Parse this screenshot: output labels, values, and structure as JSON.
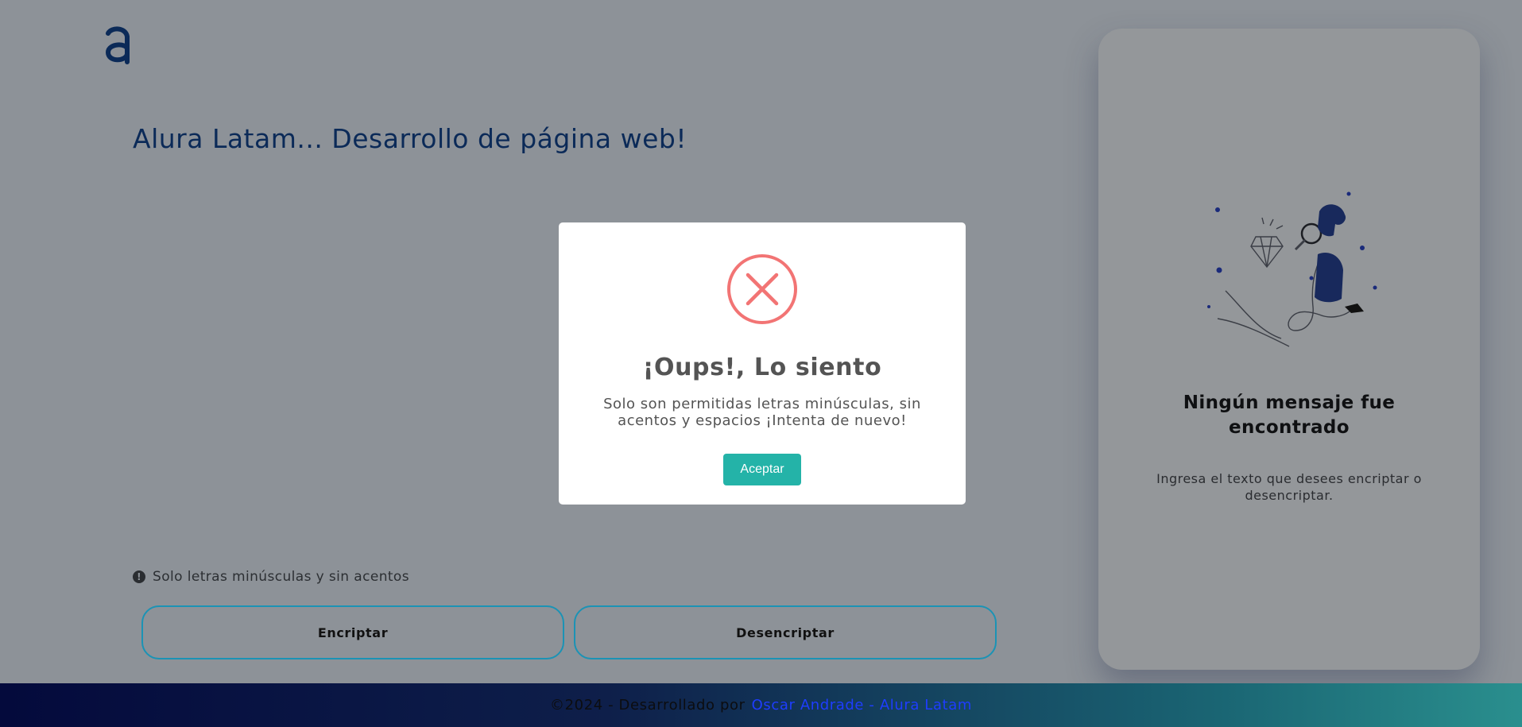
{
  "header": {
    "logo_letter": "a",
    "title": "Alura Latam... Desarrollo de página web!"
  },
  "input": {
    "hint": "Solo letras minúsculas y sin acentos",
    "hint_icon": "exclamation-circle-icon"
  },
  "actions": {
    "encrypt_label": "Encriptar",
    "decrypt_label": "Desencriptar"
  },
  "result": {
    "title": "Ningún mensaje fue encontrado",
    "subtitle": "Ingresa el texto que desees encriptar o desencriptar.",
    "illustration": "person-with-magnifying-glass-illustration"
  },
  "footer": {
    "text": "©2024 - Desarrollado por",
    "link": "Oscar Andrade - Alura Latam"
  },
  "modal": {
    "icon": "error-x-icon",
    "title": "¡Oups!, Lo siento",
    "message": "Solo son permitidas letras minúsculas, sin acentos y espacios ¡Intenta de nuevo!",
    "button_label": "Aceptar"
  },
  "colors": {
    "accent": "#24b3a8",
    "error": "#f27474",
    "brand_dark": "#0b2a58",
    "button_border": "#1b93b5"
  }
}
